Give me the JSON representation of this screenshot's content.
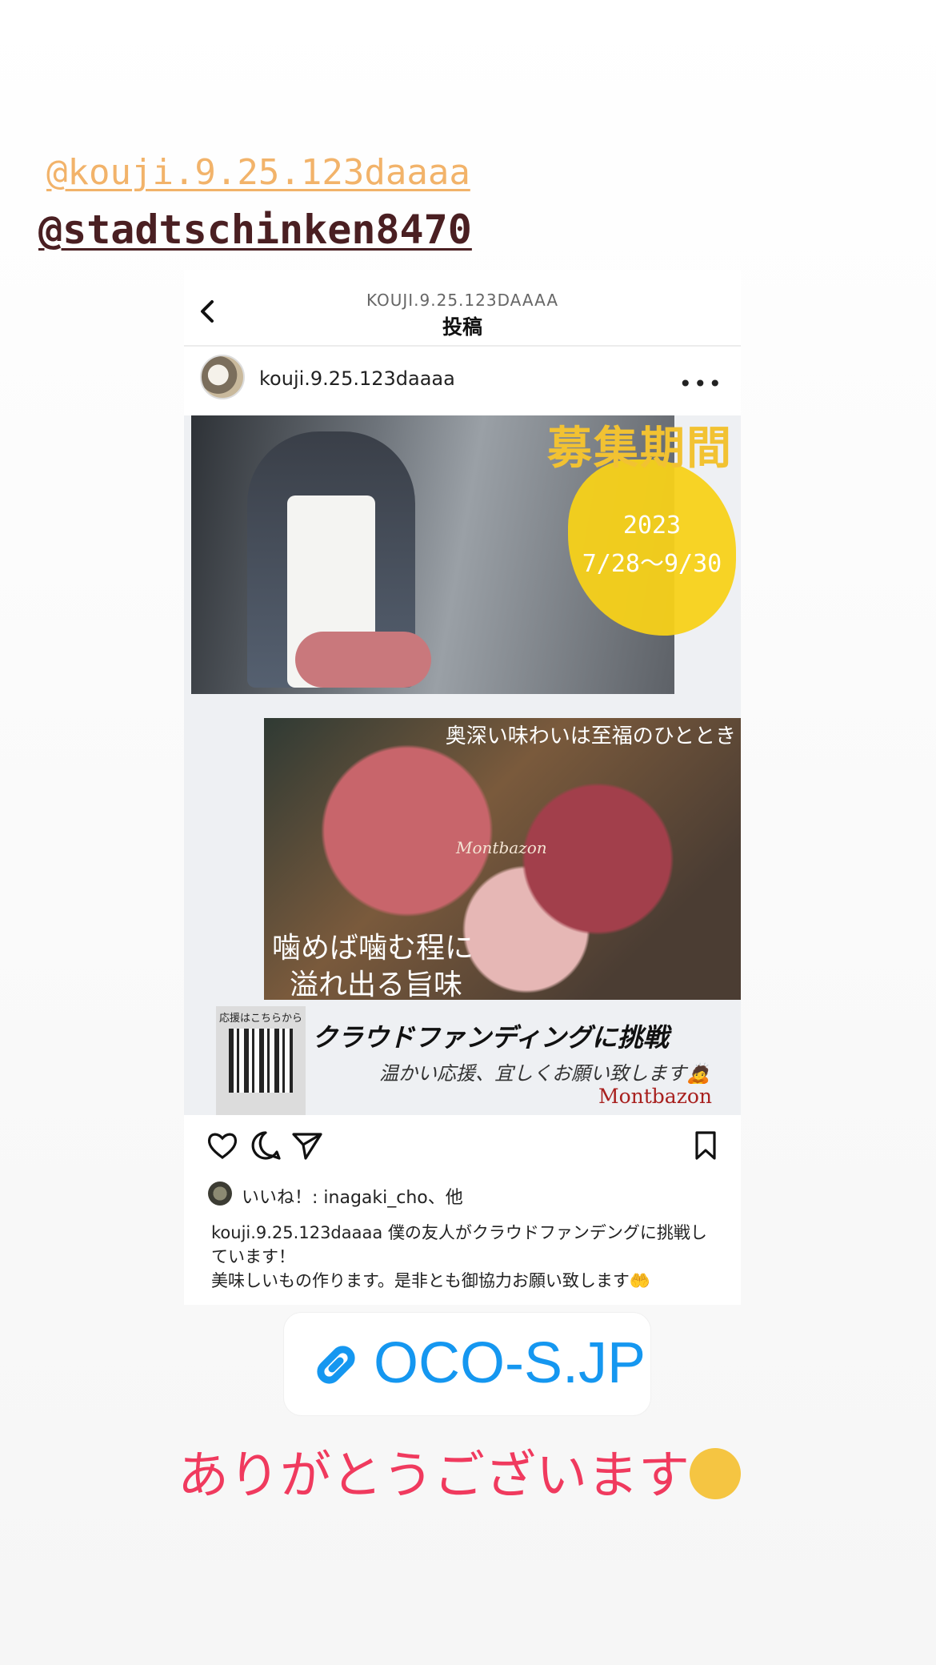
{
  "mentions": {
    "first": "@kouji.9.25.123daaaa",
    "second": "@stadtschinken8470"
  },
  "card": {
    "topbar": {
      "username_upper": "KOUJI.9.25.123DAAAA",
      "title": "投稿",
      "back_icon": "chevron-left"
    },
    "poster": {
      "username": "kouji.9.25.123daaaa",
      "more_label": "•••"
    },
    "flyer": {
      "period_title": "募集期間",
      "year": "2023",
      "range": "7/28〜9/30",
      "tagline": "奥深い味わいは至福のひととき",
      "brand_mark": "Montbazon",
      "line1": "噛めば噛む程に",
      "line2": "溢れ出る旨味",
      "qr_label": "応援はこちらから",
      "crowd_title": "クラウドファンディングに挑戦",
      "crowd_sub": "温かい応援、宜しくお願い致します🙇",
      "brand": "Montbazon"
    },
    "actions": {
      "like_icon": "heart",
      "comment_icon": "speech-bubble",
      "share_icon": "paper-plane",
      "save_icon": "bookmark"
    },
    "likes": {
      "text": "いいね！: inagaki_cho、他"
    },
    "caption": {
      "username": "kouji.9.25.123daaaa",
      "body1": "僕の友人がクラウドファンデングに挑戦しています！",
      "body2": "美味しいもの作ります。是非とも御協力お願い致します🤲"
    }
  },
  "link_sticker": {
    "icon": "link",
    "text": "OCO-S.JP",
    "color": "#1597f0"
  },
  "thanks": {
    "text": "ありがとうございます",
    "emoji": "winking-face",
    "color": "#f03a5e"
  }
}
